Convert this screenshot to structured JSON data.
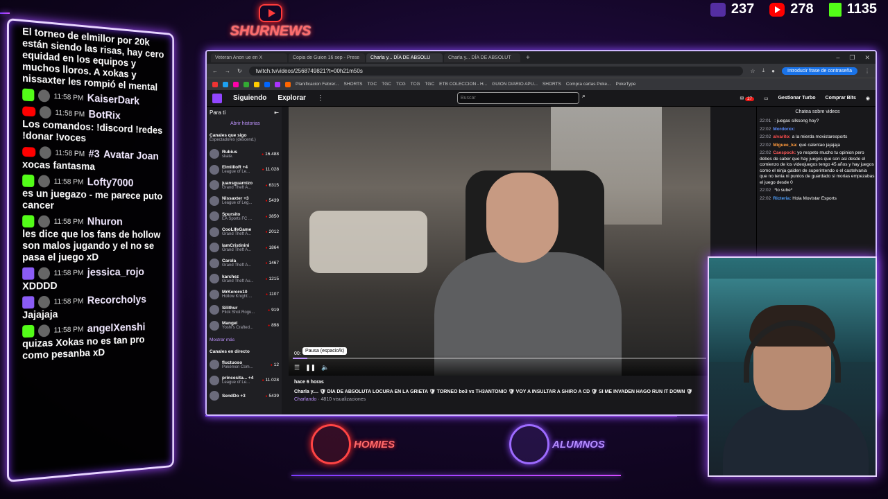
{
  "counters": [
    {
      "icon": "twitch-icon",
      "value": "237"
    },
    {
      "icon": "youtube-icon",
      "value": "278"
    },
    {
      "icon": "kick-icon",
      "value": "1135"
    }
  ],
  "brand": {
    "name": "SHURNEWS"
  },
  "overlay_chat": [
    {
      "source": "",
      "time": "",
      "user": "",
      "text": "El torneo de elmillor por 20k están siendo las risas, hay cero equidad en los equipos y muchos lloros. A xokas y nissaxter les rompió el mental"
    },
    {
      "source": "kick",
      "time": "11:58 PM",
      "user": "KaiserDark",
      "text": ""
    },
    {
      "source": "youtube",
      "time": "11:58 PM",
      "user": "BotRix",
      "text": "Los comandos: !discord !redes !donar !voces"
    },
    {
      "source": "youtube",
      "time": "11:58 PM",
      "user": "Avatar Joan",
      "badge": "#3",
      "text": "xocas fantasma"
    },
    {
      "source": "kick",
      "time": "11:58 PM",
      "user": "Lofty7000",
      "text": "es un juegazo - me parece puto cancer"
    },
    {
      "source": "kick",
      "time": "11:58 PM",
      "user": "Nhuron",
      "text": "les dice que los fans de hollow son malos jugando y el no se pasa el juego xD"
    },
    {
      "source": "twitch",
      "time": "11:58 PM",
      "user": "jessica_rojo",
      "text": "XDDDD"
    },
    {
      "source": "twitch",
      "time": "11:58 PM",
      "user": "Recorcholys",
      "text": "Jajajaja"
    },
    {
      "source": "kick",
      "time": "11:58 PM",
      "user": "angelXenshi",
      "text": "quizas Xokas no es tan pro como pesanba xD"
    }
  ],
  "browser": {
    "tabs": [
      "Veteran Anon ue en X",
      "Copia de Guion 16 sep - Prese",
      "Charla y... DÍA DE ABSOLU",
      "Charla y... DÍA DE ABSOLUT"
    ],
    "url": "twitch.tv/videos/2568749821?t=00h21m50s",
    "password_button": "Introducir frase de contraseña",
    "bookmarks": [
      "Planificacion Febrer...",
      "SHORTS",
      "TGC",
      "TGC",
      "TCG",
      "TCG",
      "TGC",
      "ETB COLECCION - H...",
      "GUION DIARIO APU...",
      "SHORTS",
      "Compra cartas Poke...",
      "PokeType"
    ]
  },
  "twitch": {
    "nav": {
      "following": "Siguiendo",
      "explore": "Explorar",
      "more": "⋮"
    },
    "search_placeholder": "Buscar",
    "notif_count": "27",
    "turbo": "Gestionar Turbo",
    "bits": "Comprar Bits",
    "sidebar": {
      "title": "Para ti",
      "history": "Abrir historias",
      "followed_title": "Canales que sigo",
      "followed_sub": "Espectadores (descend.)",
      "channels": [
        {
          "name": "Rubius",
          "game": "skate.",
          "viewers": "16.488"
        },
        {
          "name": "ElmiilloR +4",
          "game": "League of Le...",
          "viewers": "11.028"
        },
        {
          "name": "juansguarnizo",
          "game": "Grand Theft A...",
          "viewers": "6315"
        },
        {
          "name": "Nissaxter +3",
          "game": "League of Leg...",
          "viewers": "5439"
        },
        {
          "name": "Spursito",
          "game": "EA Sports FC ...",
          "viewers": "3850"
        },
        {
          "name": "CooLifeGame",
          "game": "Grand Theft A...",
          "viewers": "2012"
        },
        {
          "name": "IamCristinini",
          "game": "Grand Theft A...",
          "viewers": "1864"
        },
        {
          "name": "Carola",
          "game": "Grand Theft A...",
          "viewers": "1467"
        },
        {
          "name": "karchez",
          "game": "Grand Theft Au...",
          "viewers": "1215"
        },
        {
          "name": "MrKeroro10",
          "game": "Hollow Knight:...",
          "viewers": "1107"
        },
        {
          "name": "Silithur",
          "game": "Flick Shot Rogu...",
          "viewers": "919"
        },
        {
          "name": "Mangel",
          "game": "Yoshi's Crafted...",
          "viewers": "898"
        }
      ],
      "show_more": "Mostrar más",
      "live_title": "Canales en directo",
      "live_channels": [
        {
          "name": "fluctuoso",
          "game": "Pokémon Com...",
          "viewers": "12"
        },
        {
          "name": "princesita... +4",
          "game": "League of Le...",
          "viewers": "11.028"
        },
        {
          "name": "SendDo +3",
          "game": "",
          "viewers": "5439"
        }
      ]
    },
    "player": {
      "time": "00:",
      "tooltip": "Pausa (espacio/k)",
      "progress": 0.035,
      "icons": [
        "list-icon",
        "pause-icon",
        "volume-icon"
      ]
    },
    "video": {
      "ago": "hace 6 horas",
      "title": "Charla y.... 🛡 DÍA DE ABSOLUTA LOCURA EN LA GRIETA 🛡 TORNEO bo3 vs TH3ANTONIO 🛡 VOY A INSULTAR A SHIRO A CD 🛡 SI ME INVADEN HAGO RUN IT DOWN 🛡",
      "category": "Charlando",
      "views": "· 4810 visualizaciones"
    },
    "video_chat": {
      "title": "Chatea sobre videos",
      "messages": [
        {
          "time": "22:01",
          "user": "",
          "text": ": juegas silksong hoy?"
        },
        {
          "time": "22:02",
          "user": "Mordorxx:",
          "text": ""
        },
        {
          "time": "22:02",
          "user": "alvarito:",
          "text": "a la mierda movistaresports"
        },
        {
          "time": "22:02",
          "user": "Miguee_ka:",
          "text": "qué calentao jajajaja"
        },
        {
          "time": "22:02",
          "user": "Caespock:",
          "text": "yo respeto mucho tu opinion pero debes de saber que hay juegos que son asi desde el comienzo de los videojuegos tengo 45 años y hay juegos como el ninja gaiden de superintendo o el castelvania que no tenia ni puntos de guardado si morias empezabas el juego desde 0"
        },
        {
          "time": "22:02",
          "user": "",
          "text": "*lo sube*"
        },
        {
          "time": "22:02",
          "user": "Ricteria:",
          "text": "Hola Movistar Esports"
        }
      ]
    }
  },
  "teams": [
    {
      "name": "HOMIES",
      "color": "#ff4444"
    },
    {
      "name": "ALUMNOS",
      "color": "#9d6bff"
    }
  ]
}
